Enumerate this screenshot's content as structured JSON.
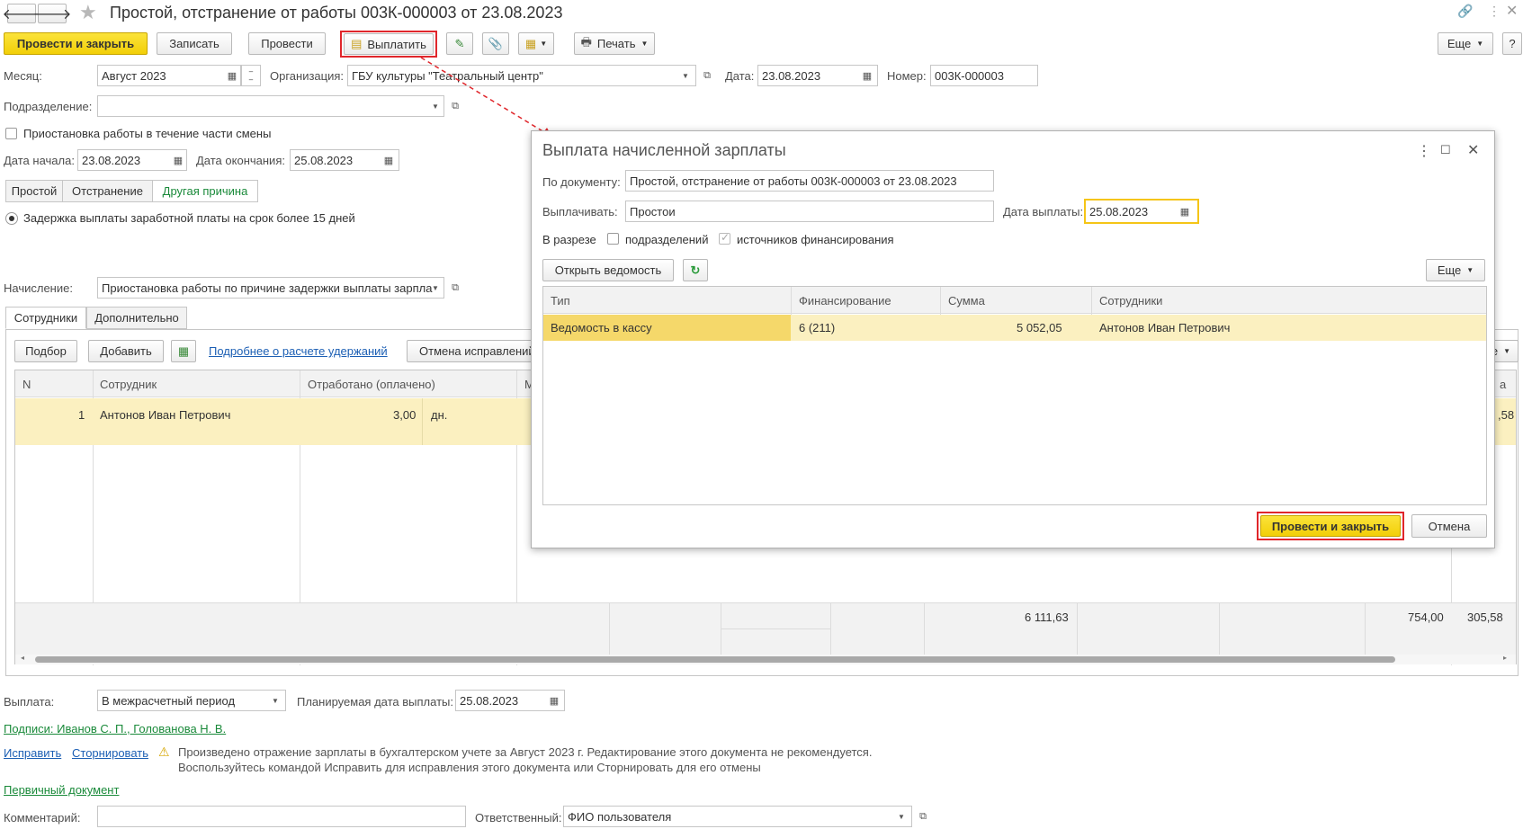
{
  "window": {
    "title": "Простой, отстранение от работы 003К-000003 от 23.08.2023"
  },
  "toolbar": {
    "post_close": "Провести и закрыть",
    "save": "Записать",
    "post": "Провести",
    "pay": "Выплатить",
    "print": "Печать",
    "more": "Еще",
    "help": "?"
  },
  "header": {
    "month_label": "Месяц:",
    "month": "Август 2023",
    "org_label": "Организация:",
    "org": "ГБУ культуры \"Театральный центр\"",
    "date_label": "Дата:",
    "date": "23.08.2023",
    "number_label": "Номер:",
    "number": "003К-000003",
    "dept_label": "Подразделение:",
    "dept": "",
    "partial_shift": "Приостановка работы в течение части смены",
    "start_label": "Дата начала:",
    "start": "23.08.2023",
    "end_label": "Дата окончания:",
    "end": "25.08.2023"
  },
  "reason_tabs": [
    "Простой",
    "Отстранение",
    "Другая причина"
  ],
  "reason_radio": "Задержка выплаты заработной платы на срок более 15 дней",
  "accrual": {
    "label": "Начисление:",
    "value": "Приостановка работы по причине задержки выплаты зарпла"
  },
  "main_tabs": [
    "Сотрудники",
    "Дополнительно"
  ],
  "emp_toolbar": {
    "pick": "Подбор",
    "add": "Добавить",
    "details_link": "Подробнее о расчете удержаний",
    "cancel_corr": "Отмена исправлений",
    "more_partial": "е"
  },
  "emp_table": {
    "headers": [
      "N",
      "Сотрудник",
      "Отработано (оплачено)",
      "М"
    ],
    "rows": [
      {
        "n": "1",
        "name": "Антонов Иван Петрович",
        "worked": "3,00",
        "unit": "дн.",
        "right": ",58"
      }
    ],
    "right_header": "а",
    "totals": {
      "t1": "6 111,63",
      "t2": "754,00",
      "t3": "305,58"
    }
  },
  "footer": {
    "payment_label": "Выплата:",
    "payment": "В межрасчетный период",
    "planned_label": "Планируемая дата выплаты:",
    "planned": "25.08.2023",
    "signatures": "Подписи: Иванов С. П., Голованова Н. В.",
    "fix": "Исправить",
    "storno": "Сторнировать",
    "warning1": "Произведено отражение зарплаты в бухгалтерском учете за Август 2023 г. Редактирование этого документа не рекомендуется.",
    "warning2": "Воспользуйтесь командой Исправить для исправления этого документа или Сторнировать для его отмены",
    "primary": "Первичный документ",
    "comment_label": "Комментарий:",
    "comment": "",
    "responsible_label": "Ответственный:",
    "responsible": "ФИО пользователя"
  },
  "dialog": {
    "title": "Выплата начисленной зарплаты",
    "doc_label": "По документу:",
    "doc": "Простой, отстранение от работы 003К-000003 от 23.08.2023",
    "pay_label": "Выплачивать:",
    "pay": "Простои",
    "paydate_label": "Дата выплаты:",
    "paydate": "25.08.2023",
    "breakdown_label": "В разрезе",
    "dept_cb": "подразделений",
    "sources_cb": "источников финансирования",
    "open_sheet": "Открыть ведомость",
    "more": "Еще",
    "headers": [
      "Тип",
      "Финансирование",
      "Сумма",
      "Сотрудники"
    ],
    "rows": [
      {
        "type": "Ведомость в кассу",
        "fin": "6  (211)",
        "sum": "5 052,05",
        "emp": "Антонов Иван Петрович"
      }
    ],
    "post_close": "Провести и закрыть",
    "cancel": "Отмена"
  },
  "colors": {
    "accent_yellow": "#f5d30f",
    "row_highlight": "#fbf0c0",
    "red_frame": "#e0262b",
    "link_green": "#1a8a3a",
    "link_blue": "#1c5fb4"
  }
}
